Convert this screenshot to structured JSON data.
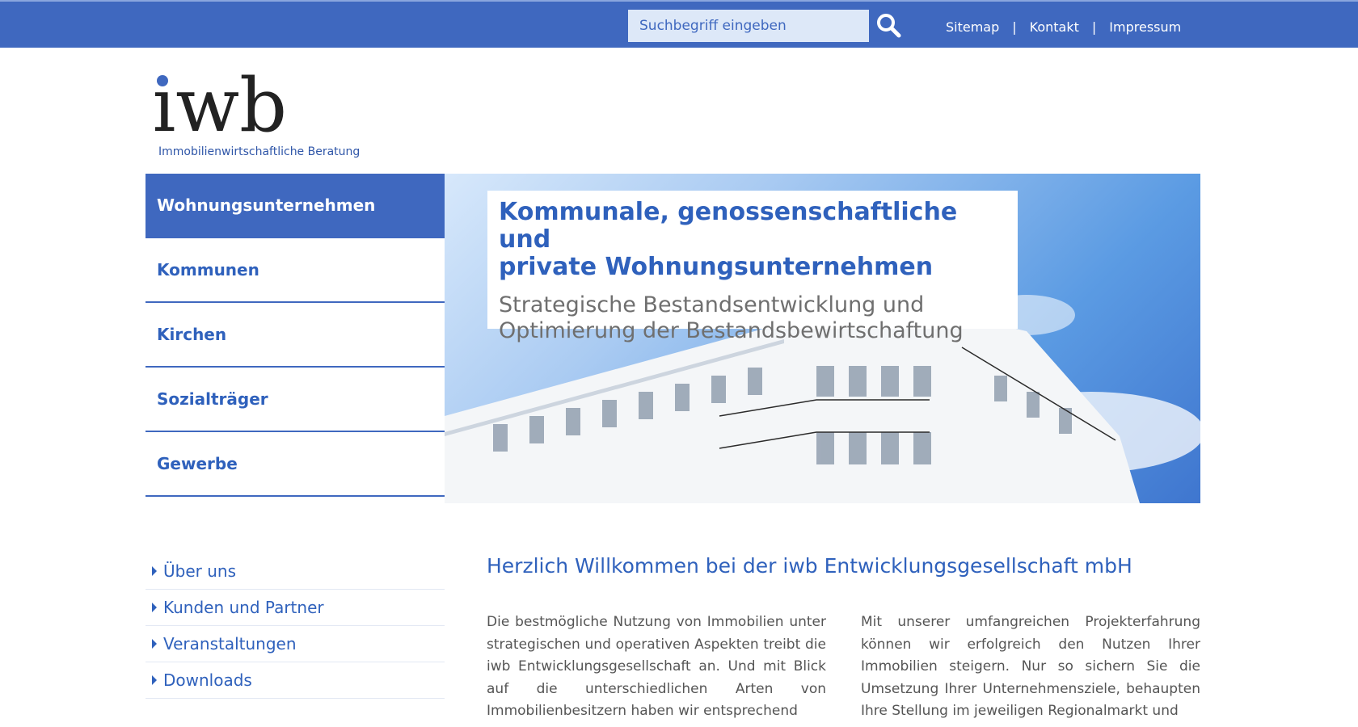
{
  "search": {
    "placeholder": "Suchbegriff eingeben",
    "value": ""
  },
  "top_nav": {
    "sitemap": "Sitemap",
    "contact": "Kontakt",
    "imprint": "Impressum",
    "separator": "|"
  },
  "logo": {
    "mark": "iwb",
    "tagline": "Immobilienwirtschaftliche Beratung"
  },
  "main_menu": {
    "items": [
      {
        "label": "Wohnungsunternehmen",
        "active": true
      },
      {
        "label": "Kommunen"
      },
      {
        "label": "Kirchen"
      },
      {
        "label": "Sozialträger"
      },
      {
        "label": "Gewerbe"
      }
    ]
  },
  "hero": {
    "title_line1": "Kommunale, genossenschaftliche und",
    "title_line2": "private Wohnungsunternehmen",
    "subtitle_line1": "Strategische Bestandsentwicklung und",
    "subtitle_line2": "Optimierung der Bestandsbewirtschaftung"
  },
  "side_nav": {
    "items": [
      {
        "label": "Über uns"
      },
      {
        "label": "Kunden und Partner"
      },
      {
        "label": "Veranstaltungen"
      },
      {
        "label": "Downloads"
      }
    ]
  },
  "content": {
    "title": "Herzlich Willkommen bei der iwb Entwicklungsgesellschaft mbH",
    "col1": "Die bestmögliche Nutzung von Immobilien unter strategischen und operativen Aspekten treibt die iwb Entwicklungsgesellschaft an. Und mit Blick auf die unterschiedlichen Arten von Immobilienbesitzern haben wir entsprechend",
    "col2": "Mit unserer umfangreichen Projekterfahrung können wir erfolgreich den Nutzen Ihrer Immobilien steigern. Nur so sichern Sie die Umsetzung Ihrer Unternehmensziele, behaupten Ihre Stellung im jeweiligen Regionalmarkt und"
  },
  "colors": {
    "brand_blue": "#3f68bf",
    "link_blue": "#2f61bc",
    "text_gray": "#555555",
    "search_bg": "#dde8f8"
  },
  "icons": {
    "search": "magnifier-icon",
    "caret": "caret-right-icon"
  }
}
